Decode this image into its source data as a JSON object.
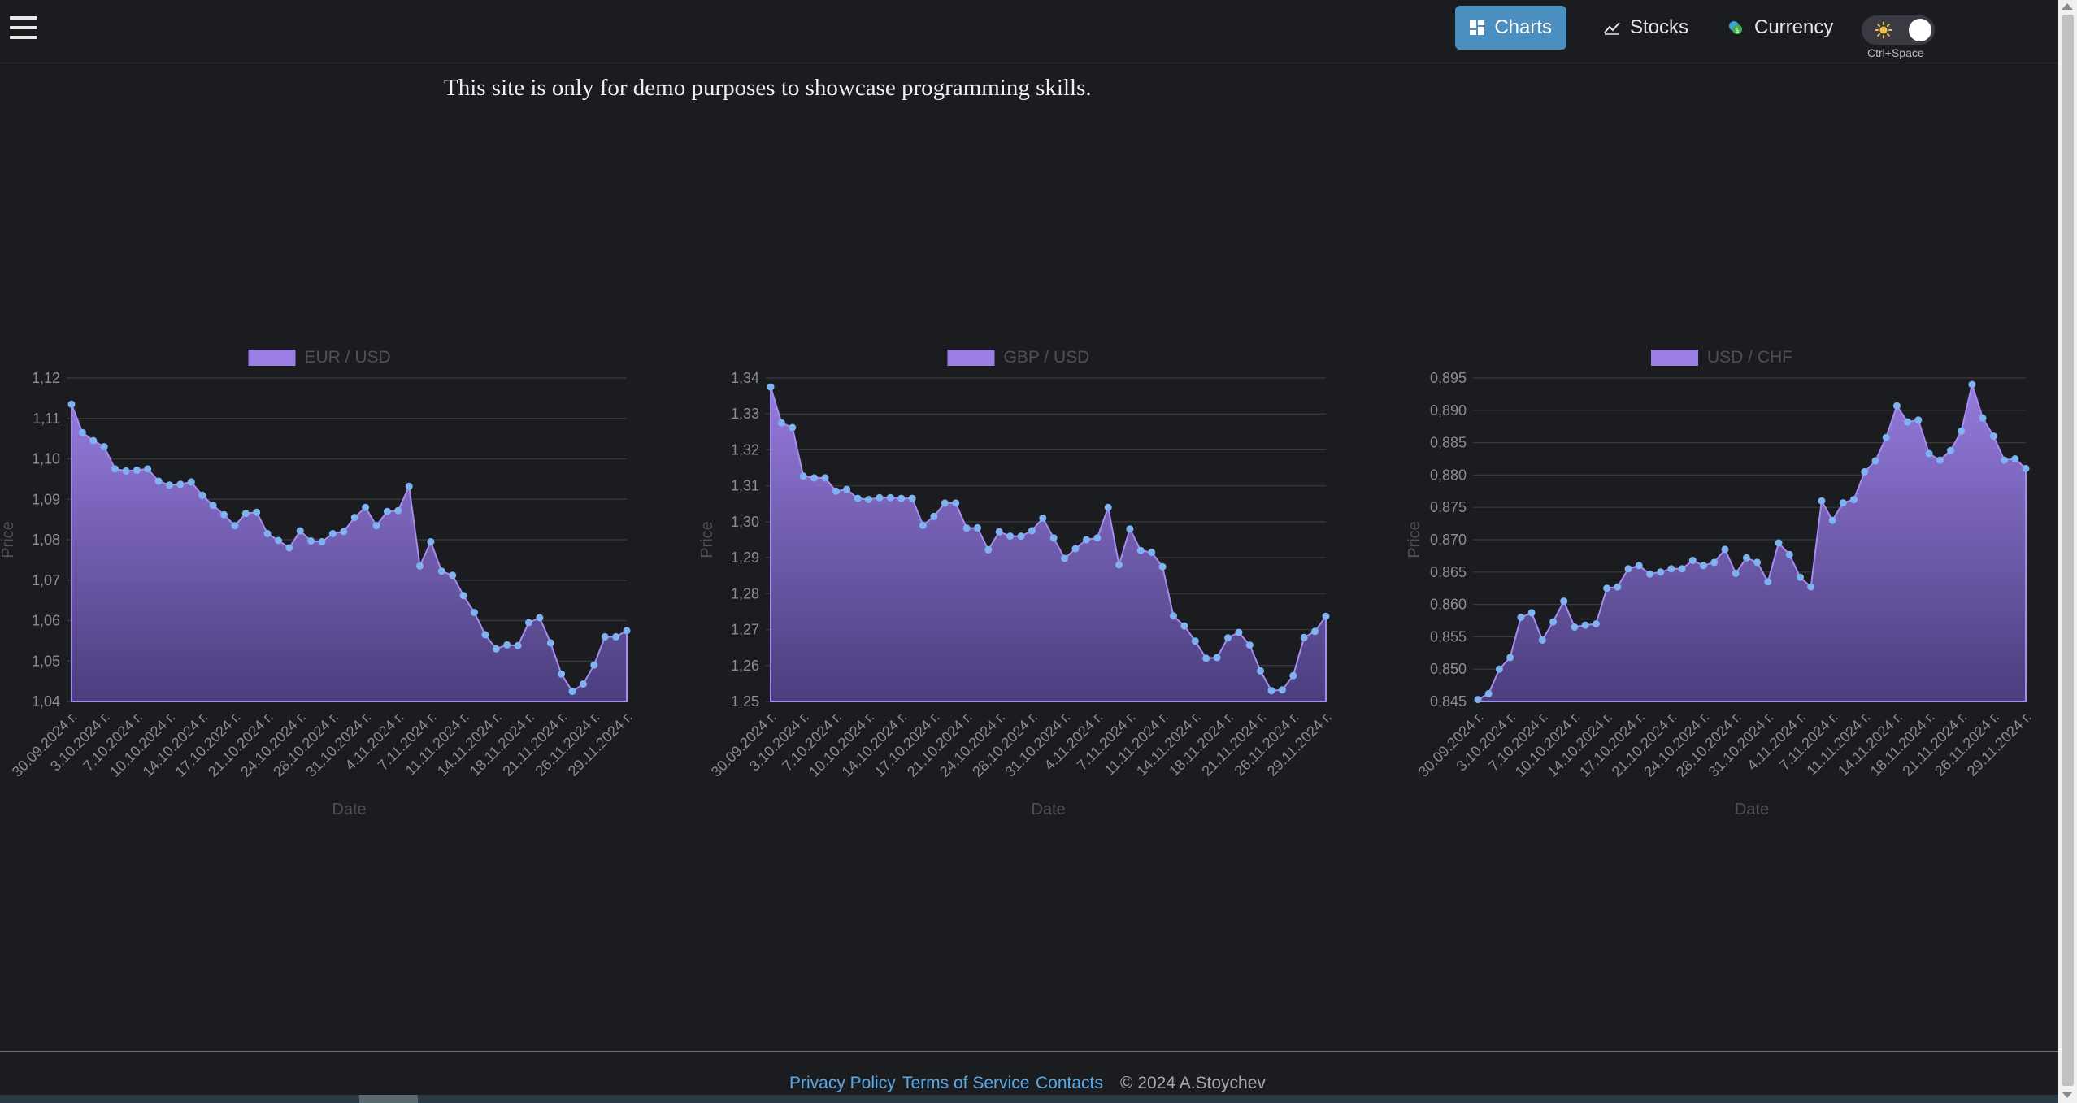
{
  "header": {
    "nav": [
      {
        "label": "Charts",
        "icon": "dashboard-icon",
        "active": true
      },
      {
        "label": "Stocks",
        "icon": "trend-line-icon",
        "active": false
      },
      {
        "label": "Currency",
        "icon": "currency-coins-icon",
        "active": false
      }
    ],
    "theme_toggle": {
      "icon": "sun-icon",
      "state": "on"
    },
    "shortcut": "Ctrl+Space"
  },
  "notice": "This site is only for demo purposes to showcase programming skills.",
  "colors": {
    "fill_top": "#9b7fe6",
    "fill_bottom": "#4d3f82",
    "point": "#7fb2f0",
    "accent": "#4a8fbf",
    "link": "#5aa9e6"
  },
  "chart_data": [
    {
      "type": "area",
      "legend": "EUR / USD",
      "xlabel": "Date",
      "ylabel": "Price",
      "ylim": [
        1.04,
        1.12
      ],
      "yticks": [
        "1,12",
        "1,11",
        "1,10",
        "1,09",
        "1,08",
        "1,07",
        "1,06",
        "1,05",
        "1,04"
      ],
      "xticks": [
        "30.09.2024 г.",
        "3.10.2024 г.",
        "7.10.2024 г.",
        "10.10.2024 г.",
        "14.10.2024 г.",
        "17.10.2024 г.",
        "21.10.2024 г.",
        "24.10.2024 г.",
        "28.10.2024 г.",
        "31.10.2024 г.",
        "4.11.2024 г.",
        "7.11.2024 г.",
        "11.11.2024 г.",
        "14.11.2024 г.",
        "18.11.2024 г.",
        "21.11.2024 г.",
        "26.11.2024 г.",
        "29.11.2024 г."
      ],
      "values": [
        1.1135,
        1.1065,
        1.1045,
        1.103,
        1.0975,
        1.097,
        1.0972,
        1.0975,
        1.0945,
        1.0935,
        1.0937,
        1.0943,
        1.091,
        1.0885,
        1.0862,
        1.0835,
        1.0865,
        1.0868,
        1.0815,
        1.0798,
        1.078,
        1.0822,
        1.0797,
        1.0795,
        1.0815,
        1.082,
        1.0855,
        1.088,
        1.0835,
        1.087,
        1.0872,
        1.0932,
        1.0735,
        1.0795,
        1.0722,
        1.0712,
        1.0662,
        1.062,
        1.0565,
        1.053,
        1.054,
        1.0538,
        1.0595,
        1.0607,
        1.0545,
        1.0468,
        1.0425,
        1.0443,
        1.049,
        1.056,
        1.056,
        1.0575
      ]
    },
    {
      "type": "area",
      "legend": "GBP / USD",
      "xlabel": "Date",
      "ylabel": "Price",
      "ylim": [
        1.25,
        1.34
      ],
      "yticks": [
        "1,34",
        "1,33",
        "1,32",
        "1,31",
        "1,30",
        "1,29",
        "1,28",
        "1,27",
        "1,26",
        "1,25"
      ],
      "xticks": [
        "30.09.2024 г.",
        "3.10.2024 г.",
        "7.10.2024 г.",
        "10.10.2024 г.",
        "14.10.2024 г.",
        "17.10.2024 г.",
        "21.10.2024 г.",
        "24.10.2024 г.",
        "28.10.2024 г.",
        "31.10.2024 г.",
        "4.11.2024 г.",
        "7.11.2024 г.",
        "11.11.2024 г.",
        "14.11.2024 г.",
        "18.11.2024 г.",
        "21.11.2024 г.",
        "26.11.2024 г.",
        "29.11.2024 г."
      ],
      "values": [
        1.3375,
        1.3275,
        1.3262,
        1.3127,
        1.3122,
        1.3122,
        1.3085,
        1.309,
        1.3065,
        1.3062,
        1.3067,
        1.3067,
        1.3065,
        1.3065,
        1.299,
        1.3015,
        1.3052,
        1.3052,
        1.2982,
        1.2983,
        1.2922,
        1.2972,
        1.296,
        1.296,
        1.2975,
        1.301,
        1.2955,
        1.2898,
        1.2925,
        1.295,
        1.2955,
        1.304,
        1.288,
        1.298,
        1.292,
        1.2915,
        1.2875,
        1.2738,
        1.271,
        1.2668,
        1.262,
        1.2622,
        1.2677,
        1.2692,
        1.2657,
        1.2585,
        1.253,
        1.2532,
        1.2572,
        1.2678,
        1.2695,
        1.2737
      ]
    },
    {
      "type": "area",
      "legend": "USD / CHF",
      "xlabel": "Date",
      "ylabel": "Price",
      "ylim": [
        0.845,
        0.895
      ],
      "yticks": [
        "0,895",
        "0,890",
        "0,885",
        "0,880",
        "0,875",
        "0,870",
        "0,865",
        "0,860",
        "0,855",
        "0,850",
        "0,845"
      ],
      "xticks": [
        "30.09.2024 г.",
        "3.10.2024 г.",
        "7.10.2024 г.",
        "10.10.2024 г.",
        "14.10.2024 г.",
        "17.10.2024 г.",
        "21.10.2024 г.",
        "24.10.2024 г.",
        "28.10.2024 г.",
        "31.10.2024 г.",
        "4.11.2024 г.",
        "7.11.2024 г.",
        "11.11.2024 г.",
        "14.11.2024 г.",
        "18.11.2024 г.",
        "21.11.2024 г.",
        "26.11.2024 г.",
        "29.11.2024 г."
      ],
      "values": [
        0.8453,
        0.8462,
        0.85,
        0.8518,
        0.858,
        0.8587,
        0.8545,
        0.8573,
        0.8605,
        0.8565,
        0.8568,
        0.857,
        0.8625,
        0.8627,
        0.8655,
        0.866,
        0.8647,
        0.865,
        0.8655,
        0.8655,
        0.8668,
        0.866,
        0.8665,
        0.8685,
        0.8648,
        0.8672,
        0.8665,
        0.8635,
        0.8695,
        0.8677,
        0.8642,
        0.8627,
        0.876,
        0.873,
        0.8757,
        0.8762,
        0.8805,
        0.8822,
        0.8858,
        0.8907,
        0.8882,
        0.8885,
        0.8833,
        0.8823,
        0.8838,
        0.8868,
        0.894,
        0.8888,
        0.886,
        0.8823,
        0.8825,
        0.881
      ]
    }
  ],
  "footer": {
    "links": [
      "Privacy Policy",
      "Terms of Service",
      "Contacts"
    ],
    "copyright": "© 2024 A.Stoychev"
  }
}
